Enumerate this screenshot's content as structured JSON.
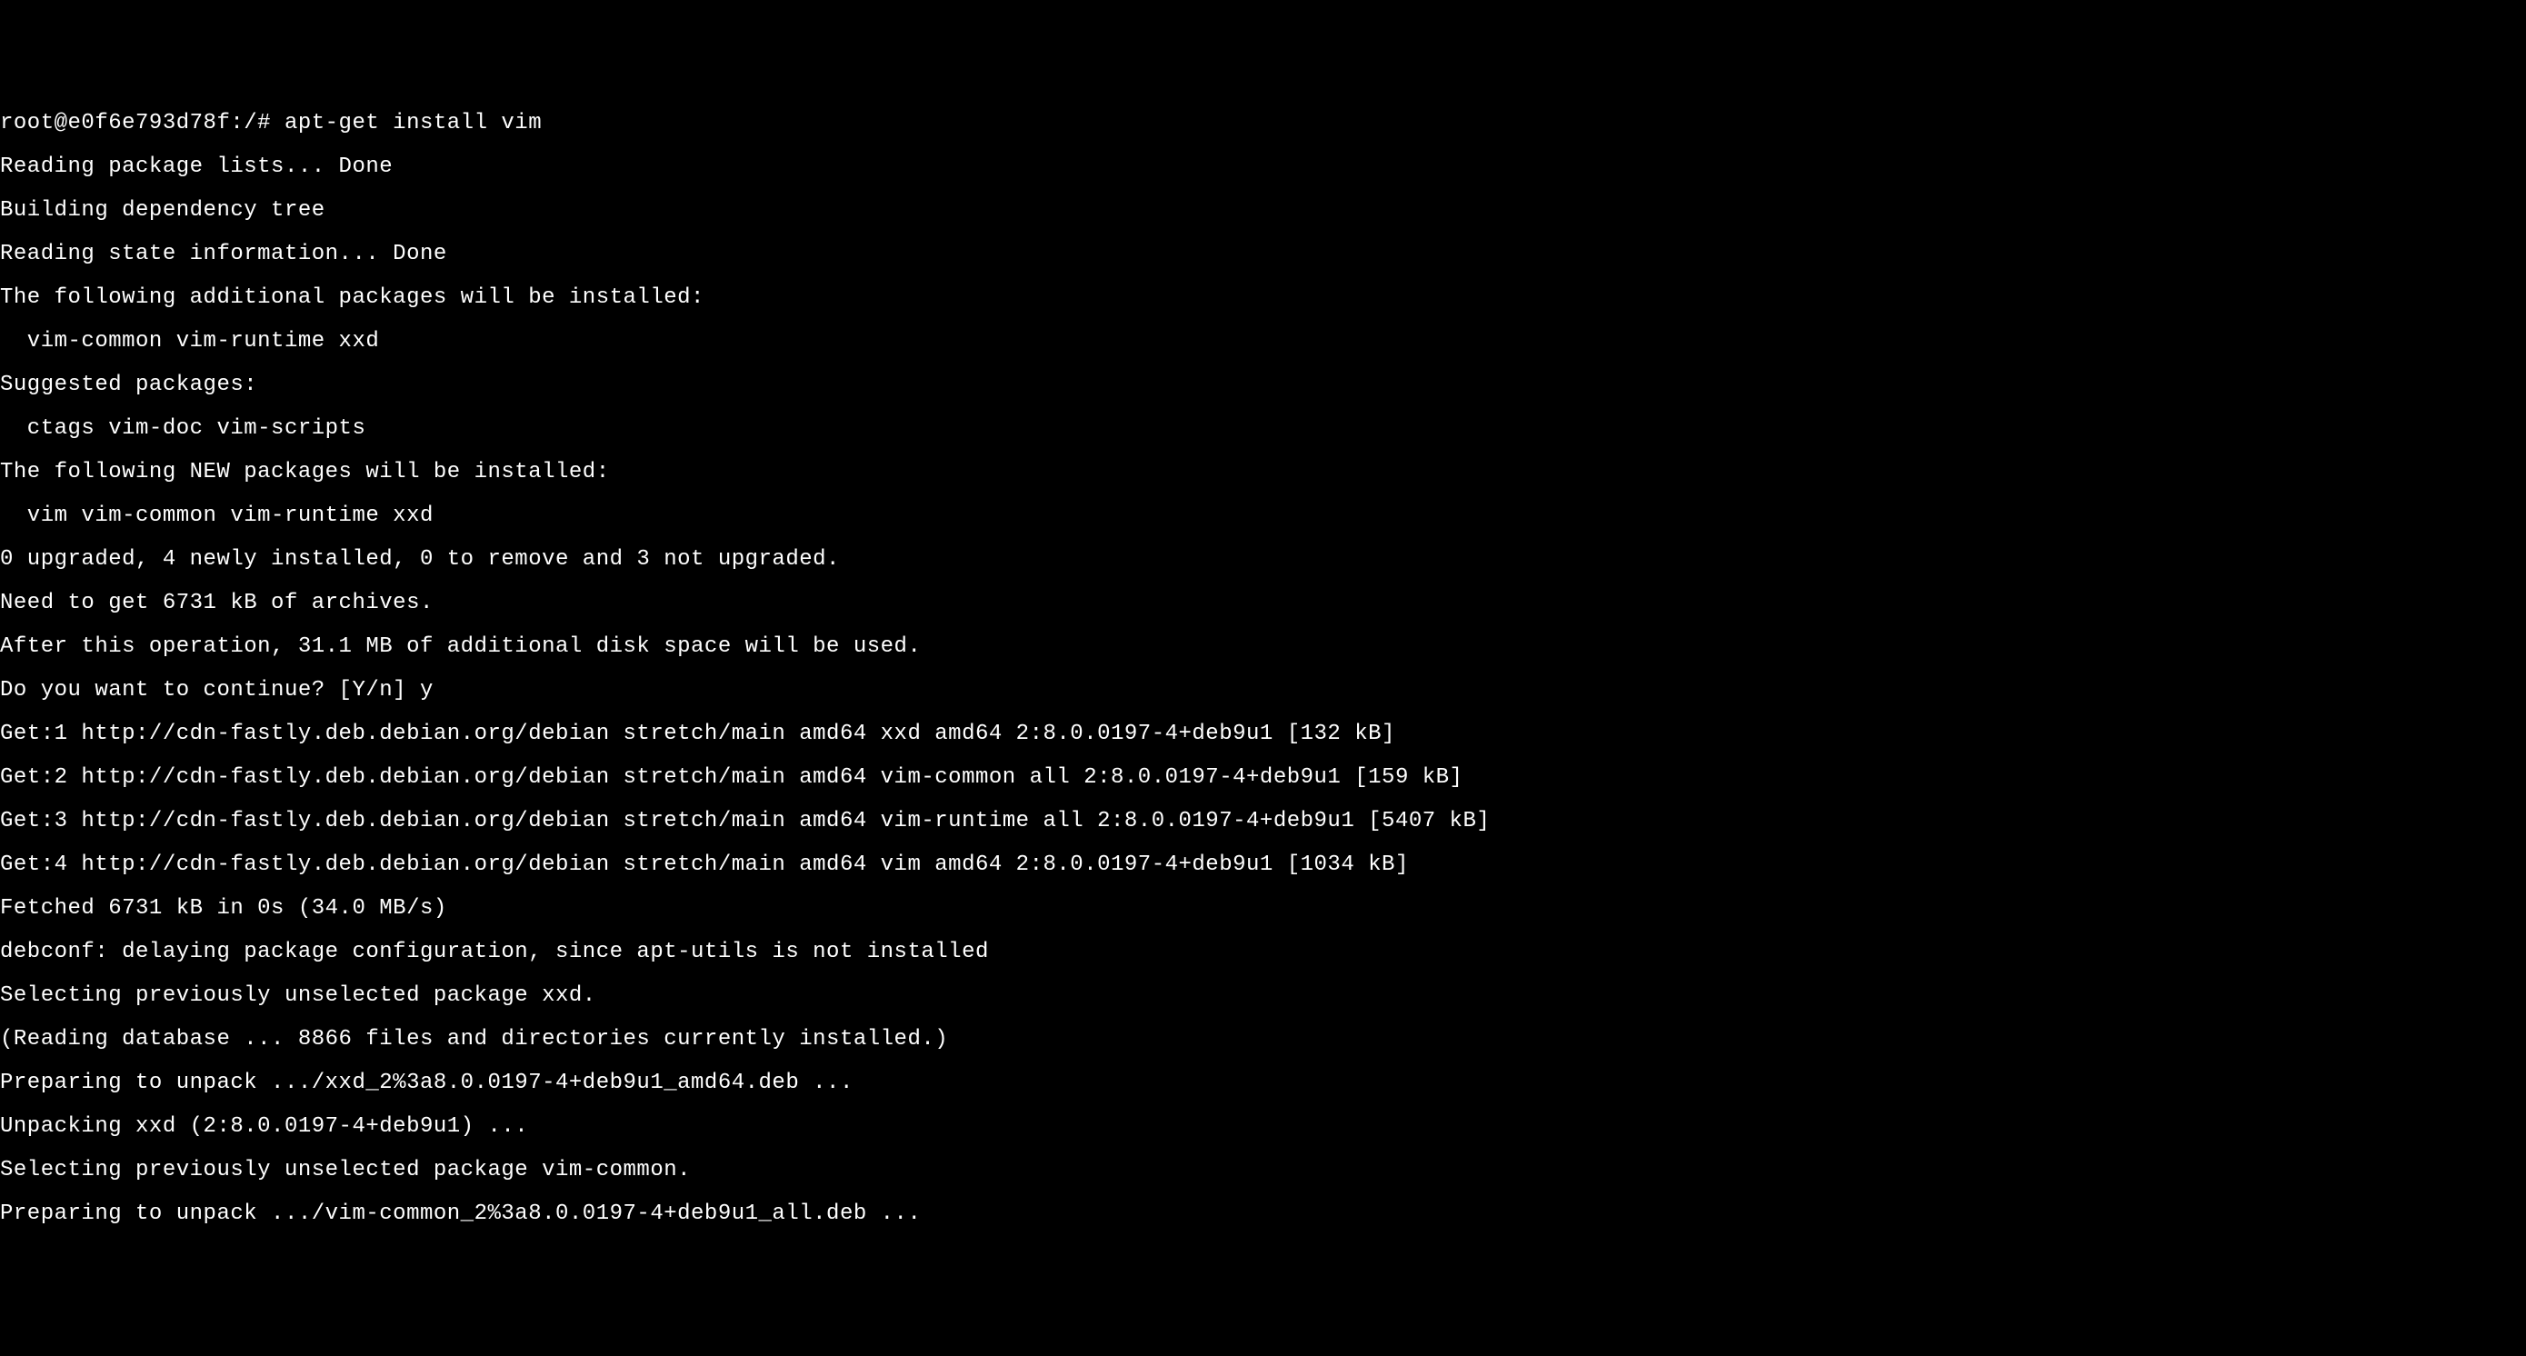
{
  "terminal": {
    "lines": [
      "root@e0f6e793d78f:/# apt-get install vim",
      "Reading package lists... Done",
      "Building dependency tree",
      "Reading state information... Done",
      "The following additional packages will be installed:",
      "  vim-common vim-runtime xxd",
      "Suggested packages:",
      "  ctags vim-doc vim-scripts",
      "The following NEW packages will be installed:",
      "  vim vim-common vim-runtime xxd",
      "0 upgraded, 4 newly installed, 0 to remove and 3 not upgraded.",
      "Need to get 6731 kB of archives.",
      "After this operation, 31.1 MB of additional disk space will be used.",
      "Do you want to continue? [Y/n] y",
      "Get:1 http://cdn-fastly.deb.debian.org/debian stretch/main amd64 xxd amd64 2:8.0.0197-4+deb9u1 [132 kB]",
      "Get:2 http://cdn-fastly.deb.debian.org/debian stretch/main amd64 vim-common all 2:8.0.0197-4+deb9u1 [159 kB]",
      "Get:3 http://cdn-fastly.deb.debian.org/debian stretch/main amd64 vim-runtime all 2:8.0.0197-4+deb9u1 [5407 kB]",
      "Get:4 http://cdn-fastly.deb.debian.org/debian stretch/main amd64 vim amd64 2:8.0.0197-4+deb9u1 [1034 kB]",
      "Fetched 6731 kB in 0s (34.0 MB/s)",
      "debconf: delaying package configuration, since apt-utils is not installed",
      "Selecting previously unselected package xxd.",
      "(Reading database ... 8866 files and directories currently installed.)",
      "Preparing to unpack .../xxd_2%3a8.0.0197-4+deb9u1_amd64.deb ...",
      "Unpacking xxd (2:8.0.0197-4+deb9u1) ...",
      "Selecting previously unselected package vim-common.",
      "Preparing to unpack .../vim-common_2%3a8.0.0197-4+deb9u1_all.deb ..."
    ]
  }
}
